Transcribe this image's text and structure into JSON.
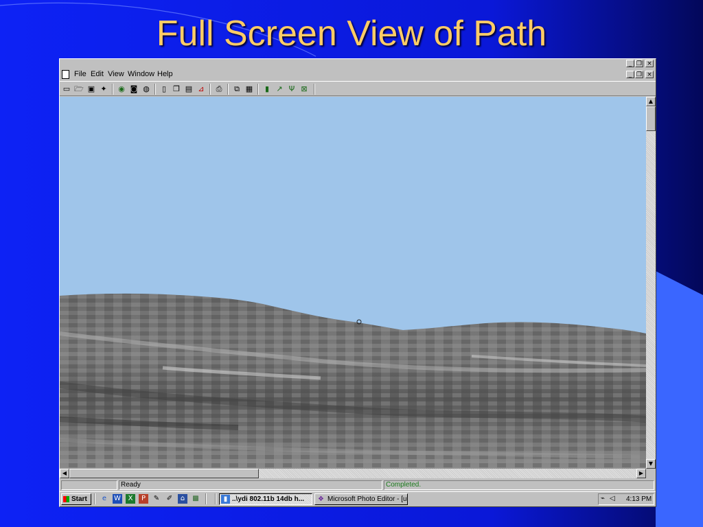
{
  "slide": {
    "title": "Full Screen View of Path"
  },
  "menu": {
    "items": [
      "File",
      "Edit",
      "View",
      "Window",
      "Help"
    ]
  },
  "toolbar": {
    "buttons": [
      {
        "icon": "new-file-icon",
        "glyph": "▭"
      },
      {
        "icon": "open-folder-icon",
        "glyph": "🗁"
      },
      {
        "icon": "save-icon",
        "glyph": "▣"
      },
      {
        "icon": "tools-icon",
        "glyph": "✦"
      },
      {
        "icon": "globe-icon",
        "glyph": "◉"
      },
      {
        "icon": "record-icon",
        "glyph": "◙"
      },
      {
        "icon": "query-icon",
        "glyph": "◍"
      },
      {
        "icon": "page-icon",
        "glyph": "▯"
      },
      {
        "icon": "copy-page-icon",
        "glyph": "❐"
      },
      {
        "icon": "document-icon",
        "glyph": "▤"
      },
      {
        "icon": "pdf-icon",
        "glyph": "⊿"
      },
      {
        "icon": "print-icon",
        "glyph": "⎙"
      },
      {
        "icon": "copy-icon",
        "glyph": "⧉"
      },
      {
        "icon": "paste-icon",
        "glyph": "▦"
      },
      {
        "icon": "book-icon",
        "glyph": "▮"
      },
      {
        "icon": "link-icon",
        "glyph": "↗"
      },
      {
        "icon": "antenna-icon",
        "glyph": "Ψ"
      },
      {
        "icon": "close-view-icon",
        "glyph": "⊠"
      }
    ]
  },
  "status": {
    "left": "Ready",
    "right": "Completed."
  },
  "taskbar": {
    "start_label": "Start",
    "quick_launch": [
      {
        "icon": "ie-icon",
        "glyph": "e"
      },
      {
        "icon": "word-icon",
        "glyph": "W"
      },
      {
        "icon": "excel-icon",
        "glyph": "X"
      },
      {
        "icon": "powerpoint-icon",
        "glyph": "P"
      },
      {
        "icon": "paint-icon",
        "glyph": "✎"
      },
      {
        "icon": "notepad-icon",
        "glyph": "✐"
      },
      {
        "icon": "network-icon",
        "glyph": "⌂"
      },
      {
        "icon": "map-icon",
        "glyph": "▩"
      }
    ],
    "tasks": [
      {
        "label": "..\\ydi 802.11b 14db h...",
        "active": true,
        "icon": "terrain-app-icon"
      },
      {
        "label": "Microsoft Photo Editor - [u...",
        "active": false,
        "icon": "photo-editor-icon"
      }
    ],
    "clock": "4:13 PM"
  },
  "colors": {
    "sky": "#9fc5ea",
    "slide_bg": "#0a1cf0",
    "title": "#ffcc66"
  }
}
